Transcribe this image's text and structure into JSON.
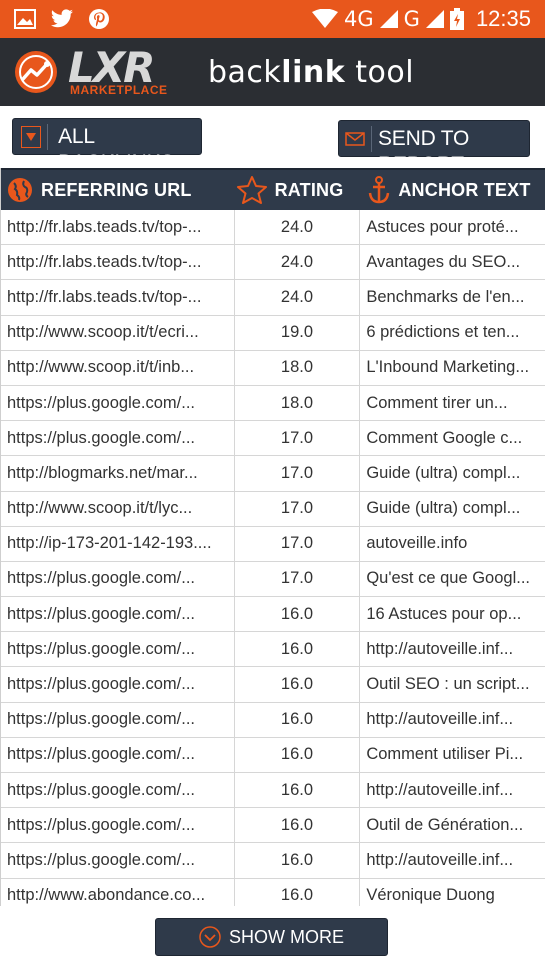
{
  "status_bar": {
    "network": "4G",
    "network2": "G",
    "time": "12:35"
  },
  "header": {
    "brand": "LXR",
    "brand_sub": "MARKETPLACE",
    "title_light": "back",
    "title_bold": "link",
    "title_suffix": "tool"
  },
  "toolbar": {
    "filter_label": "ALL BACKLINKS",
    "send_label": "SEND TO REPORT"
  },
  "table": {
    "columns": {
      "url": "REFERRING URL",
      "rating": "RATING",
      "anchor": "ANCHOR TEXT"
    },
    "rows": [
      {
        "url": "http://fr.labs.teads.tv/top-...",
        "rating": "24.0",
        "anchor": "Astuces pour proté..."
      },
      {
        "url": "http://fr.labs.teads.tv/top-...",
        "rating": "24.0",
        "anchor": "Avantages du SEO..."
      },
      {
        "url": "http://fr.labs.teads.tv/top-...",
        "rating": "24.0",
        "anchor": "Benchmarks de l'en..."
      },
      {
        "url": "http://www.scoop.it/t/ecri...",
        "rating": "19.0",
        "anchor": "6 prédictions et ten..."
      },
      {
        "url": "http://www.scoop.it/t/inb...",
        "rating": "18.0",
        "anchor": "L'Inbound Marketing..."
      },
      {
        "url": "https://plus.google.com/...",
        "rating": "18.0",
        "anchor": "Comment tirer un..."
      },
      {
        "url": "https://plus.google.com/...",
        "rating": "17.0",
        "anchor": "Comment Google c..."
      },
      {
        "url": "http://blogmarks.net/mar...",
        "rating": "17.0",
        "anchor": "Guide (ultra) compl..."
      },
      {
        "url": "http://www.scoop.it/t/lyc...",
        "rating": "17.0",
        "anchor": "Guide (ultra) compl..."
      },
      {
        "url": "http://ip-173-201-142-193....",
        "rating": "17.0",
        "anchor": "autoveille.info"
      },
      {
        "url": "https://plus.google.com/...",
        "rating": "17.0",
        "anchor": "Qu'est ce que Googl..."
      },
      {
        "url": "https://plus.google.com/...",
        "rating": "16.0",
        "anchor": "16 Astuces pour op..."
      },
      {
        "url": "https://plus.google.com/...",
        "rating": "16.0",
        "anchor": "http://autoveille.inf..."
      },
      {
        "url": "https://plus.google.com/...",
        "rating": "16.0",
        "anchor": "Outil SEO : un script..."
      },
      {
        "url": "https://plus.google.com/...",
        "rating": "16.0",
        "anchor": "http://autoveille.inf..."
      },
      {
        "url": "https://plus.google.com/...",
        "rating": "16.0",
        "anchor": "Comment utiliser Pi..."
      },
      {
        "url": "https://plus.google.com/...",
        "rating": "16.0",
        "anchor": "http://autoveille.inf..."
      },
      {
        "url": "https://plus.google.com/...",
        "rating": "16.0",
        "anchor": "Outil de Génération..."
      },
      {
        "url": "https://plus.google.com/...",
        "rating": "16.0",
        "anchor": "http://autoveille.inf..."
      },
      {
        "url": "http://www.abondance.co...",
        "rating": "16.0",
        "anchor": "Véronique Duong"
      }
    ]
  },
  "footer": {
    "show_more_label": "SHOW MORE"
  },
  "colors": {
    "accent": "#e8571c",
    "header_bg": "#2b2e33",
    "button_bg": "#2f3a4a"
  }
}
